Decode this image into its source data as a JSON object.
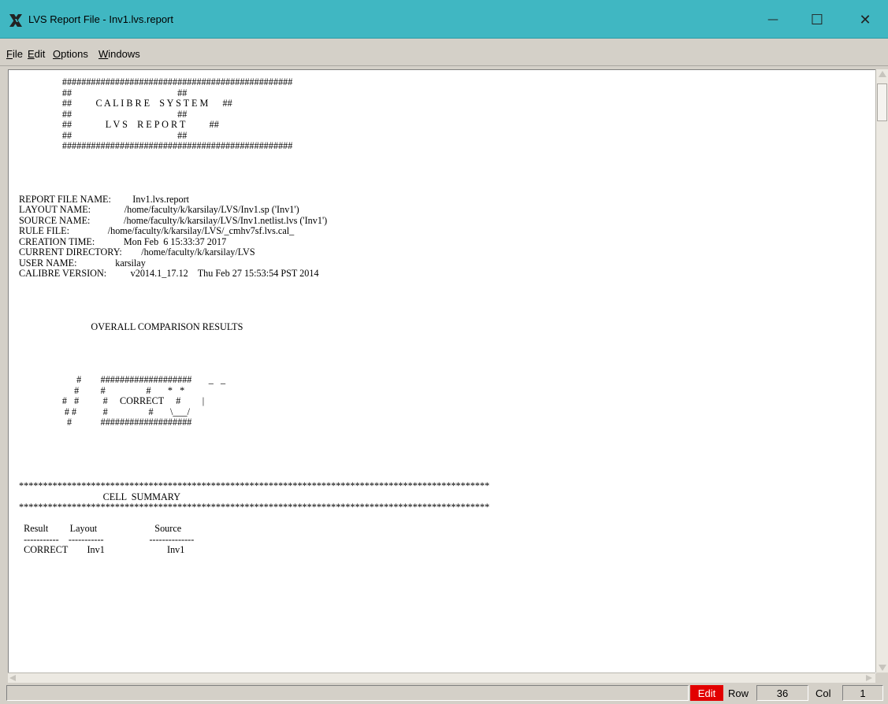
{
  "window": {
    "title": "LVS Report File - Inv1.lvs.report",
    "minimize_glyph": "—",
    "maximize_glyph": "☐",
    "close_glyph": "✕"
  },
  "menu": {
    "file": {
      "key": "F",
      "rest": "ile"
    },
    "edit": {
      "key": "E",
      "rest": "dit"
    },
    "options": {
      "key": "O",
      "rest": "ptions"
    },
    "windows": {
      "key": "W",
      "rest": "indows"
    }
  },
  "report_lines": [
    "                  ################################################",
    "                  ##                                            ##",
    "                  ##          C A L I B R E    S Y S T E M      ##",
    "                  ##                                            ##",
    "                  ##              L V S    R E P O R T          ##",
    "                  ##                                            ##",
    "                  ################################################",
    "",
    "",
    "",
    "",
    "REPORT FILE NAME:         Inv1.lvs.report",
    "LAYOUT NAME:              /home/faculty/k/karsilay/LVS/Inv1.sp ('Inv1')",
    "SOURCE NAME:              /home/faculty/k/karsilay/LVS/Inv1.netlist.lvs ('Inv1')",
    "RULE FILE:                /home/faculty/k/karsilay/LVS/_cmhv7sf.lvs.cal_",
    "CREATION TIME:            Mon Feb  6 15:33:37 2017",
    "CURRENT DIRECTORY:        /home/faculty/k/karsilay/LVS",
    "USER NAME:                karsilay",
    "CALIBRE VERSION:          v2014.1_17.12    Thu Feb 27 15:53:54 PST 2014",
    "",
    "",
    "",
    "",
    "                              OVERALL COMPARISON RESULTS",
    "",
    "",
    "",
    "",
    "                        #        ###################       _   _",
    "                       #         #                 #       *   *",
    "                  #   #          #     CORRECT     #         |",
    "                   # #           #                 #       \\___/",
    "                    #            ###################",
    "",
    "",
    "",
    "",
    "",
    "**************************************************************************************************",
    "                                   CELL  SUMMARY",
    "**************************************************************************************************",
    "",
    "  Result         Layout                        Source",
    "  -----------    -----------                   --------------",
    "  CORRECT        Inv1                          Inv1"
  ],
  "status": {
    "mode": "Edit",
    "row_label": "Row",
    "row_value": "36",
    "col_label": "Col",
    "col_value": "1"
  },
  "colors": {
    "titlebar": "#40b7c2",
    "edit_badge": "#e20000"
  },
  "icons": {
    "app": "x-window-icon"
  }
}
